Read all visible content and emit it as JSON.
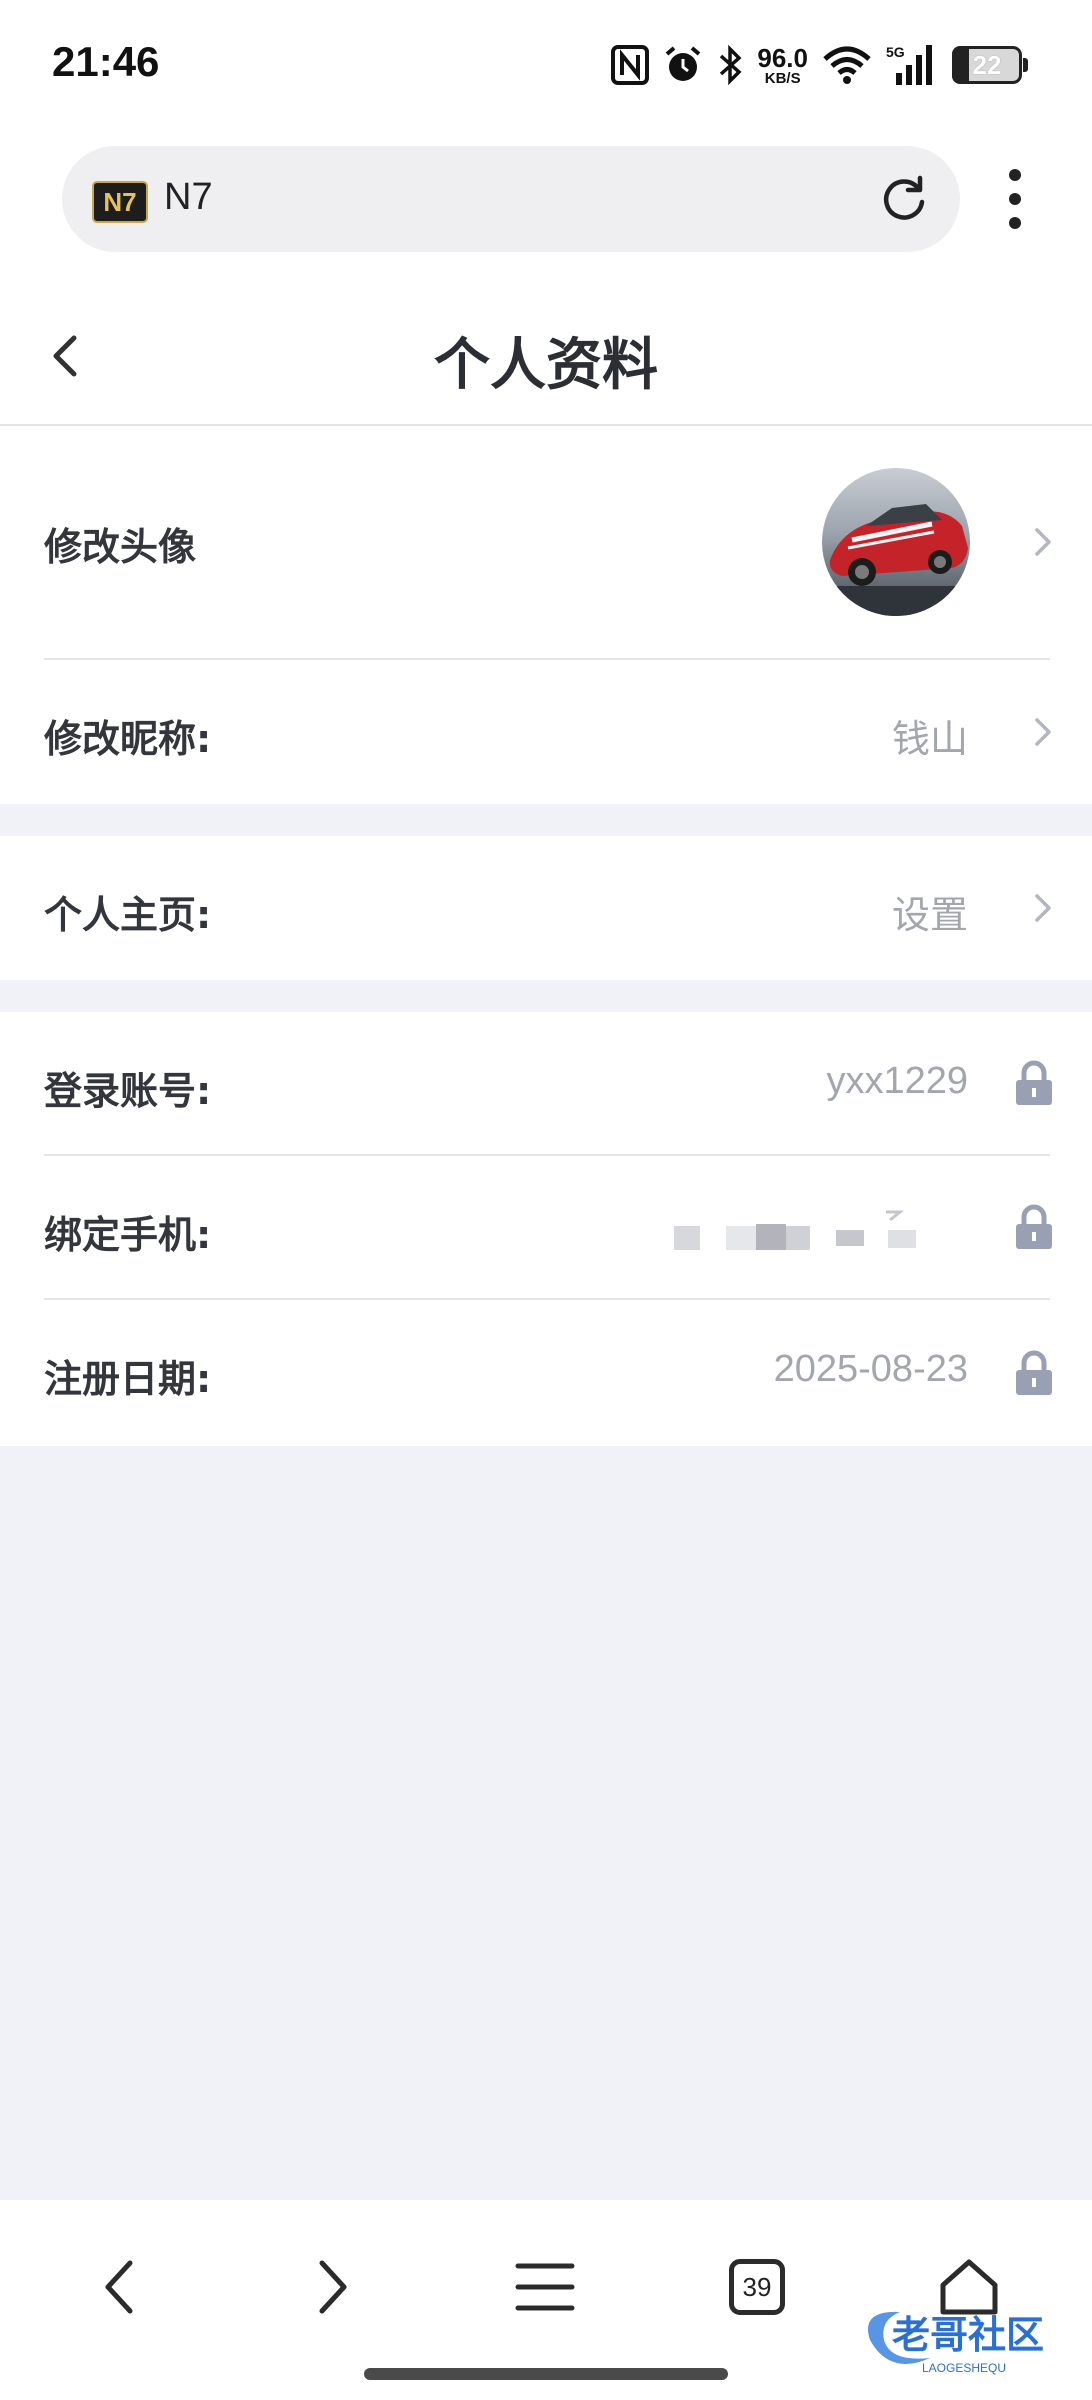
{
  "status_bar": {
    "time": "21:46",
    "net_speed_value": "96.0",
    "net_speed_unit": "KB/S",
    "network": "5G",
    "battery": "22",
    "icons": [
      "nfc-icon",
      "alarm-icon",
      "bluetooth-icon",
      "wifi-icon",
      "signal-icon",
      "battery-icon"
    ]
  },
  "browser": {
    "badge": "N7",
    "title": "N7"
  },
  "header": {
    "title": "个人资料"
  },
  "profile": {
    "avatar_label": "修改头像",
    "nickname_label": "修改昵称:",
    "nickname_value": "钱山",
    "homepage_label": "个人主页:",
    "homepage_value": "设置",
    "account_label": "登录账号:",
    "account_value": "yxx1229",
    "phone_label": "绑定手机:",
    "register_label": "注册日期:",
    "register_value": "2025-08-23"
  },
  "nav": {
    "tab_count": "39"
  },
  "watermark": {
    "text": "老哥社区",
    "sub": "LAOGESHEQU"
  },
  "colors": {
    "page_bg": "#ffffff",
    "gap_bg": "#f1f2f7",
    "value_gray": "#a3a6ad",
    "lock_gray": "#9aa0b4"
  }
}
